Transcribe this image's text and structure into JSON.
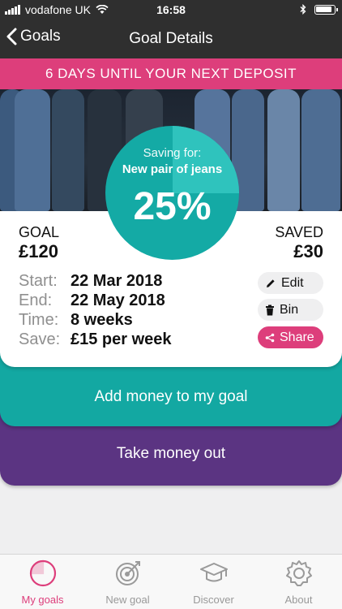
{
  "status_bar": {
    "carrier": "vodafone UK",
    "time": "16:58"
  },
  "nav": {
    "back_label": "Goals",
    "title": "Goal Details"
  },
  "banner": {
    "text": "6 DAYS UNTIL YOUR NEXT DEPOSIT"
  },
  "progress": {
    "saving_for_label": "Saving for:",
    "goal_name": "New pair of jeans",
    "percent_text": "25%",
    "percent_value": 25
  },
  "goal": {
    "label": "GOAL",
    "amount": "£120"
  },
  "saved": {
    "label": "SAVED",
    "amount": "£30"
  },
  "details": [
    {
      "key": "Start:",
      "value": "22 Mar 2018"
    },
    {
      "key": "End:",
      "value": "22 May 2018"
    },
    {
      "key": "Time:",
      "value": "8 weeks"
    },
    {
      "key": "Save:",
      "value": "£15 per week"
    }
  ],
  "actions": {
    "edit": "Edit",
    "bin": "Bin",
    "share": "Share"
  },
  "buttons": {
    "add_money": "Add money to my goal",
    "take_money": "Take money out"
  },
  "tabs": [
    {
      "label": "My goals",
      "icon": "pie-chart-icon",
      "active": true
    },
    {
      "label": "New goal",
      "icon": "target-icon",
      "active": false
    },
    {
      "label": "Discover",
      "icon": "graduation-cap-icon",
      "active": false
    },
    {
      "label": "About",
      "icon": "gear-icon",
      "active": false
    }
  ],
  "colors": {
    "accent_pink": "#dd3e7b",
    "teal": "#13a8a2",
    "purple": "#5b3482",
    "dark_bar": "#2f2f2f"
  }
}
